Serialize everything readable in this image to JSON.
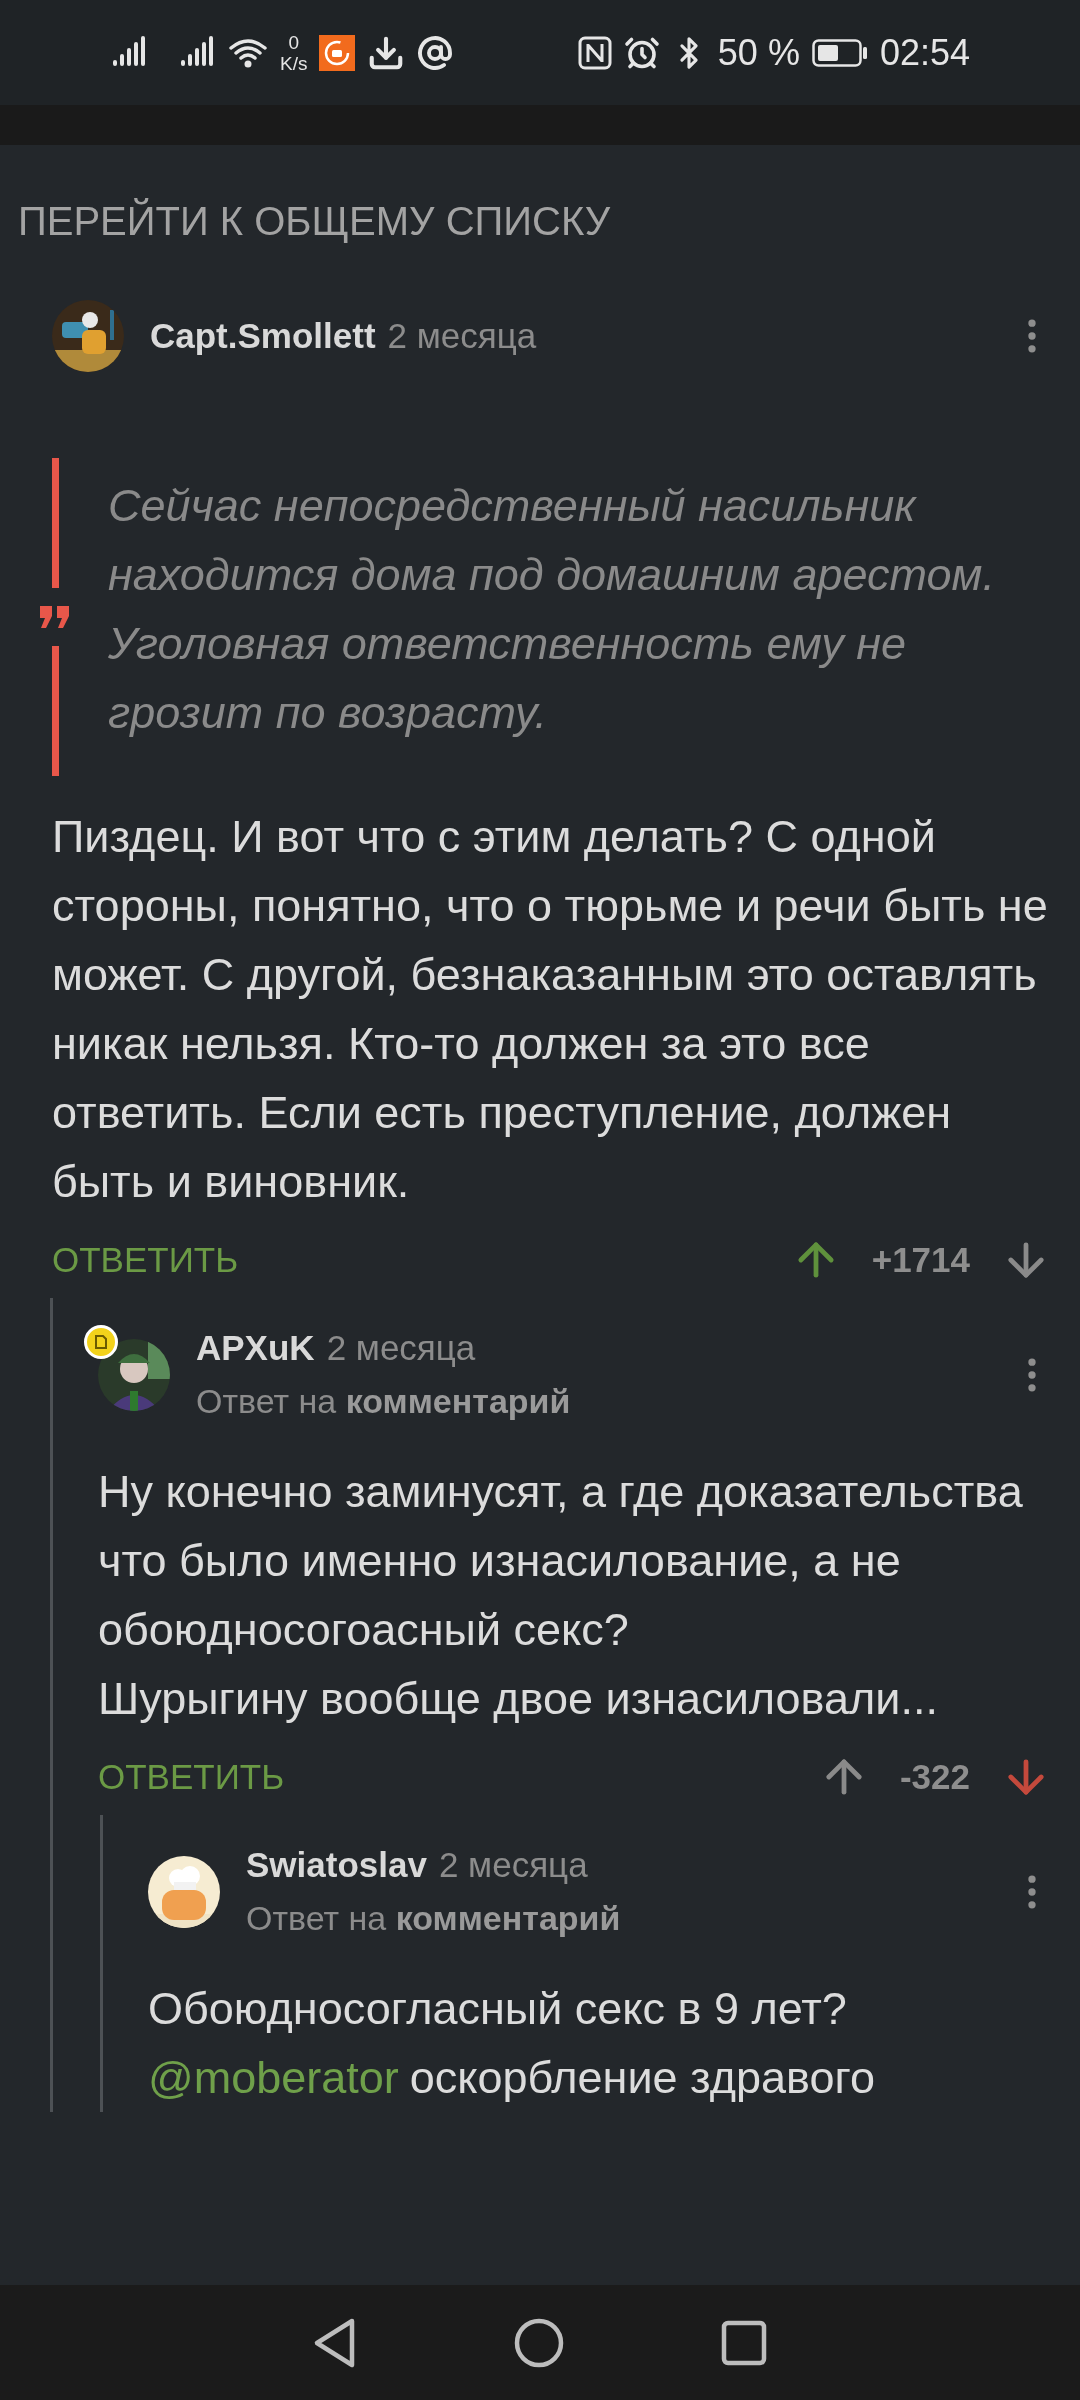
{
  "status_bar": {
    "speed_value": "0",
    "speed_unit": "K/s",
    "battery": "50 %",
    "time": "02:54"
  },
  "back_link": "ПЕРЕЙТИ К ОБЩЕМУ СПИСКУ",
  "comments": [
    {
      "author": "Capt.Smollett",
      "time": "2 месяца",
      "badge": false,
      "quote": "Сейчас непосредственный насильник находится дома под домашним арестом. Уголовная ответственность ему не грозит по возрасту.",
      "paragraphs": [
        {
          "text": "Пиздец. И вот что с этим делать? С одной стороны, понятно, что о тюрьме и речи быть не может. С другой, безнаказанным это оставлять никак нельзя. Кто-то должен за это все ответить. Если есть преступление, должен быть и виновник."
        }
      ],
      "actions": {
        "reply": "ОТВЕТИТЬ",
        "rating": "+1714",
        "upvoted": true,
        "downvoted": false
      },
      "children": [
        {
          "author": "APXuK",
          "time": "2 месяца",
          "badge": true,
          "reply_to": {
            "prefix": "Ответ на",
            "target": "комментарий"
          },
          "paragraphs": [
            {
              "text": "Ну конечно заминусят, а где доказательства что было именно изнасилование, а не обоюдносогоасный секс?"
            },
            {
              "text": "Шурыгину вообще двое изнасиловали..."
            }
          ],
          "actions": {
            "reply": "ОТВЕТИТЬ",
            "rating": "-322",
            "upvoted": false,
            "downvoted": true
          },
          "children": [
            {
              "author": "Swiatoslav",
              "time": "2 месяца",
              "badge": false,
              "reply_to": {
                "prefix": "Ответ на",
                "target": "комментарий"
              },
              "paragraphs": [
                {
                  "text": "Обоюдносогласный секс в 9 лет?"
                },
                {
                  "mention": "@moberator",
                  "text": "оскорбление здравого"
                }
              ]
            }
          ]
        }
      ]
    }
  ]
}
